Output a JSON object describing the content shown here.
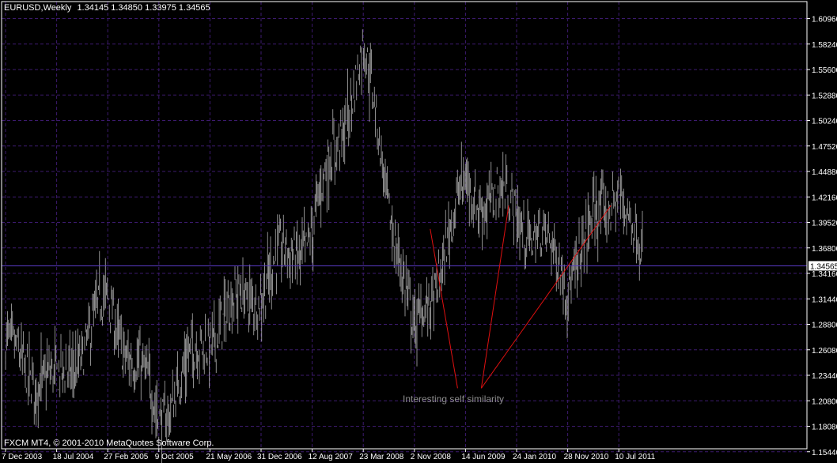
{
  "header": {
    "symbol": "EURUSD,Weekly",
    "ohlc": "1.34145 1.34850 1.33975 1.34565"
  },
  "footer": {
    "copyright": "FXCM MT4, © 2001-2010 MetaQuotes Software Corp."
  },
  "colors": {
    "background": "#000000",
    "grid": "#3c1a6e",
    "bar": "#b0b0b0",
    "axis": "#ffffff",
    "price_line": "#5a3cc8",
    "annotation_line": "#e01010",
    "annotation_text": "#8c8c8c",
    "price_label_bg": "#ffffff",
    "price_label_text": "#000000"
  },
  "chart_data": {
    "type": "ohlc",
    "ylim": [
      1.164,
      1.624
    ],
    "y_ticks": [
      "1.60960",
      "1.58240",
      "1.55600",
      "1.52880",
      "1.50240",
      "1.47520",
      "1.44880",
      "1.42160",
      "1.39520",
      "1.36800",
      "1.34160",
      "1.31440",
      "1.28800",
      "1.26080",
      "1.23440",
      "1.20800",
      "1.18080",
      "1.15440"
    ],
    "x_ticks": [
      "7 Dec 2003",
      "18 Jul 2004",
      "27 Feb 2005",
      "9 Oct 2005",
      "21 May 2006",
      "31 Dec 2006",
      "12 Aug 2007",
      "23 Mar 2008",
      "2 Nov 2008",
      "14 Jun 2009",
      "24 Jan 2010",
      "28 Nov 2010",
      "10 Jul 2011"
    ],
    "last_price": "1.34565",
    "last_price_value": 1.34565,
    "price_path": [
      [
        "7 Dec 2003",
        1.255
      ],
      [
        "18 Jul 2004",
        1.215
      ],
      [
        "27 Feb 2005",
        1.305
      ],
      [
        "9 Oct 2005",
        1.185
      ],
      [
        "21 May 2006",
        1.275
      ],
      [
        "31 Dec 2006",
        1.325
      ],
      [
        "12 Aug 2007",
        1.385
      ],
      [
        "23 Mar 2008",
        1.575
      ],
      [
        "2 Nov 2008",
        1.265
      ],
      [
        "14 Jun 2009",
        1.43
      ],
      [
        "24 Jan 2010",
        1.405
      ],
      [
        "28 Nov 2010",
        1.335
      ],
      [
        "10 Jul 2011",
        1.435
      ]
    ],
    "annotation": {
      "text": "Interesting self similarity",
      "lines": [
        [
          [
            "2 Nov 2008",
            1.385
          ],
          [
            "14 Jun 2009",
            1.215
          ]
        ],
        [
          [
            "14 Jun 2009",
            1.215
          ],
          [
            "24 Jan 2010",
            1.41
          ]
        ],
        [
          [
            "14 Jun 2009",
            1.215
          ],
          [
            "10 Jul 2011",
            1.41
          ]
        ]
      ]
    }
  }
}
